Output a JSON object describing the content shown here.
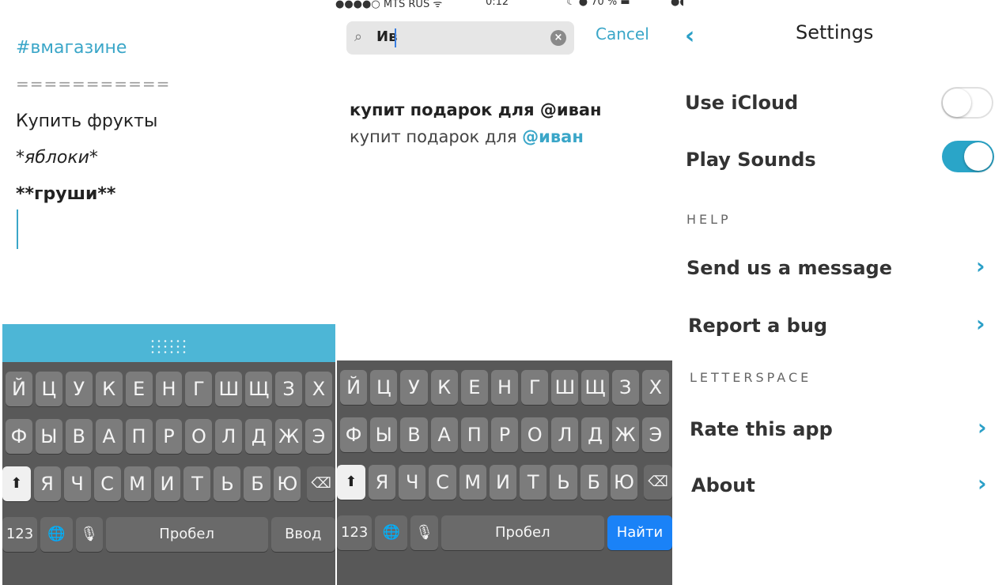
{
  "editor": {
    "hashtag": "#вмагазине",
    "rule": "===========",
    "line1": "Купить фрукты",
    "line2": "*яблоки*",
    "line3": "**груши**"
  },
  "status": {
    "carrier": "●●●●○ MTS RUS ᯤ",
    "time": "0:12",
    "battery": "☾ ● 70 % ▬",
    "carrier2": "●●●●○ MTS RUS"
  },
  "search": {
    "value": "Ив",
    "cancel": "Cancel",
    "result_title": "купит подарок для @иван",
    "result_prefix": "купит подарок для ",
    "result_mention": "@иван"
  },
  "keyboard": {
    "row1": [
      "Й",
      "Ц",
      "У",
      "К",
      "Е",
      "Н",
      "Г",
      "Ш",
      "Щ",
      "З",
      "Х"
    ],
    "row2": [
      "Ф",
      "Ы",
      "В",
      "А",
      "П",
      "Р",
      "О",
      "Л",
      "Д",
      "Ж",
      "Э"
    ],
    "row3": [
      "Я",
      "Ч",
      "С",
      "М",
      "И",
      "Т",
      "Ь",
      "Б",
      "Ю"
    ],
    "numbers": "123",
    "space": "Пробел",
    "return_left": "Ввод",
    "return_right": "Найти"
  },
  "settings": {
    "title": "Settings",
    "use_icloud": "Use iCloud",
    "use_icloud_on": false,
    "play_sounds": "Play Sounds",
    "play_sounds_on": true,
    "help_section": "HELP",
    "send_message": "Send us a message",
    "report_bug": "Report a bug",
    "letterspace_section": "LETTERSPACE",
    "rate_app": "Rate this app",
    "about": "About"
  },
  "colors": {
    "accent": "#3aa6c8",
    "keyboard_bg": "#595959",
    "key": "#7c7c7c",
    "search_key": "#1a82f7"
  }
}
